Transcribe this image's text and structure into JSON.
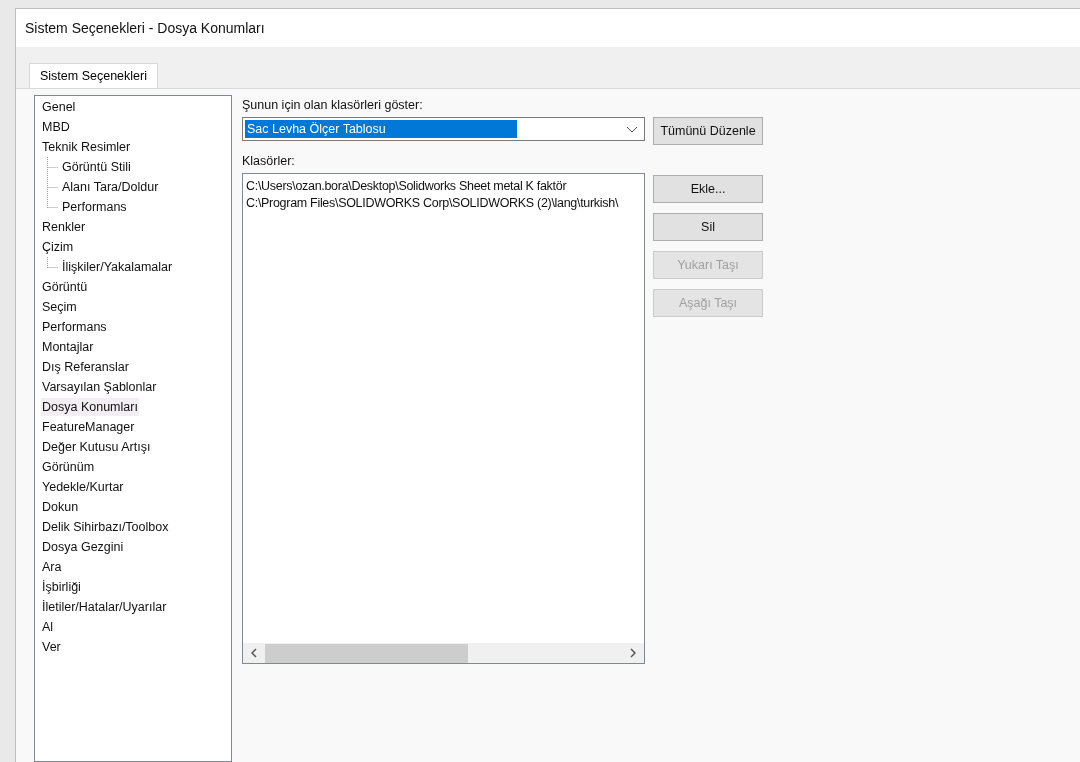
{
  "window": {
    "title": "Sistem Seçenekleri - Dosya Konumları"
  },
  "tabs": [
    {
      "label": "Sistem Seçenekleri",
      "selected": true
    }
  ],
  "tree": [
    {
      "label": "Genel",
      "selected": false
    },
    {
      "label": "MBD",
      "selected": false
    },
    {
      "label": "Teknik Resimler",
      "selected": false,
      "children": [
        {
          "label": "Görüntü Stili",
          "selected": false
        },
        {
          "label": "Alanı Tara/Doldur",
          "selected": false
        },
        {
          "label": "Performans",
          "selected": false
        }
      ]
    },
    {
      "label": "Renkler",
      "selected": false
    },
    {
      "label": "Çizim",
      "selected": false,
      "children": [
        {
          "label": "İlişkiler/Yakalamalar",
          "selected": false
        }
      ]
    },
    {
      "label": "Görüntü",
      "selected": false
    },
    {
      "label": "Seçim",
      "selected": false
    },
    {
      "label": "Performans",
      "selected": false
    },
    {
      "label": "Montajlar",
      "selected": false
    },
    {
      "label": "Dış Referanslar",
      "selected": false
    },
    {
      "label": "Varsayılan Şablonlar",
      "selected": false
    },
    {
      "label": "Dosya Konumları",
      "selected": true
    },
    {
      "label": "FeatureManager",
      "selected": false
    },
    {
      "label": "Değer Kutusu Artışı",
      "selected": false
    },
    {
      "label": "Görünüm",
      "selected": false
    },
    {
      "label": "Yedekle/Kurtar",
      "selected": false
    },
    {
      "label": "Dokun",
      "selected": false
    },
    {
      "label": "Delik Sihirbazı/Toolbox",
      "selected": false
    },
    {
      "label": "Dosya Gezgini",
      "selected": false
    },
    {
      "label": "Ara",
      "selected": false
    },
    {
      "label": "İşbirliği",
      "selected": false
    },
    {
      "label": "İletiler/Hatalar/Uyarılar",
      "selected": false
    },
    {
      "label": "Al",
      "selected": false
    },
    {
      "label": "Ver",
      "selected": false
    }
  ],
  "show_folders_for": {
    "label": "Şunun için olan klasörleri göster:",
    "value": "Sac Levha Ölçer Tablosu"
  },
  "edit_all_button": {
    "label": "Tümünü Düzenle"
  },
  "folders": {
    "label": "Klasörler:",
    "items": [
      "C:\\Users\\ozan.bora\\Desktop\\Solidworks Sheet metal K faktör",
      "C:\\Program Files\\SOLIDWORKS Corp\\SOLIDWORKS (2)\\lang\\turkish\\"
    ]
  },
  "folder_buttons": [
    {
      "label": "Ekle...",
      "disabled": false
    },
    {
      "label": "Sil",
      "disabled": false
    },
    {
      "label": "Yukarı Taşı",
      "disabled": true
    },
    {
      "label": "Aşağı Taşı",
      "disabled": true
    }
  ]
}
